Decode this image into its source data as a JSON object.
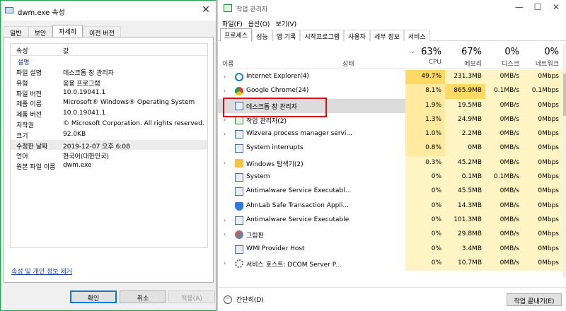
{
  "dialog": {
    "title": "dwm.exe 속성",
    "tabs": [
      "일반",
      "보안",
      "자세히",
      "이전 버전"
    ],
    "active_tab_index": 2,
    "columns": {
      "property": "속성",
      "value": "값"
    },
    "section": "설명",
    "rows": [
      {
        "property": "파일 설명",
        "value": "데스크톱 창 관리자"
      },
      {
        "property": "유형",
        "value": "응용 프로그램"
      },
      {
        "property": "파일 버전",
        "value": "10.0.19041.1"
      },
      {
        "property": "제품 이름",
        "value": "Microsoft® Windows® Operating System"
      },
      {
        "property": "제품 버전",
        "value": "10.0.19041.1"
      },
      {
        "property": "저작권",
        "value": "© Microsoft Corporation. All rights reserved."
      },
      {
        "property": "크기",
        "value": "92.0KB"
      },
      {
        "property": "수정한 날짜",
        "value": "2019-12-07 오후 6:08"
      },
      {
        "property": "언어",
        "value": "한국어(대한민국)"
      },
      {
        "property": "원본 파일 이름",
        "value": "dwm.exe"
      }
    ],
    "selected_row_index": 7,
    "remove_link": "속성 및 개인 정보 제거",
    "buttons": {
      "ok": "확인",
      "cancel": "취소",
      "apply": "적용(A)"
    },
    "close_glyph": "✕"
  },
  "taskmgr": {
    "title": "작업 관리자",
    "window_controls": {
      "minimize": "—",
      "maximize": "☐",
      "close": "✕"
    },
    "menu": [
      "파일(F)",
      "옵션(O)",
      "보기(V)"
    ],
    "tabs": [
      "프로세스",
      "성능",
      "앱 기록",
      "시작프로그램",
      "사용자",
      "세부 정보",
      "서비스"
    ],
    "active_tab_index": 0,
    "columns": {
      "name": "이름",
      "status": "상태",
      "cpu": {
        "pct": "63%",
        "label": "CPU"
      },
      "memory": {
        "pct": "67%",
        "label": "메모리"
      },
      "disk": {
        "pct": "0%",
        "label": "디스크"
      },
      "network": {
        "pct": "0%",
        "label": "네트워크"
      }
    },
    "processes": [
      {
        "name": "Internet Explorer(4)",
        "expandable": true,
        "icon": "ie-icon",
        "cpu": "49.7%",
        "mem": "231.3MB",
        "disk": "0MB/s",
        "net": "0Mbps"
      },
      {
        "name": "Google Chrome(24)",
        "expandable": true,
        "icon": "chrome-icon",
        "cpu": "8.1%",
        "mem": "865.9MB",
        "disk": "0.1MB/s",
        "net": "0.1Mbps"
      },
      {
        "name": "데스크톱 창 관리자",
        "expandable": false,
        "icon": "window-icon",
        "cpu": "1.9%",
        "mem": "19.5MB",
        "disk": "0MB/s",
        "net": "0Mbps"
      },
      {
        "name": "작업 관리자(2)",
        "expandable": true,
        "icon": "taskmgr-icon",
        "cpu": "1.3%",
        "mem": "24.9MB",
        "disk": "0MB/s",
        "net": "0Mbps"
      },
      {
        "name": "Wizvera process manager servi...",
        "expandable": true,
        "icon": "window-icon",
        "cpu": "1.0%",
        "mem": "2.2MB",
        "disk": "0MB/s",
        "net": "0Mbps"
      },
      {
        "name": "System interrupts",
        "expandable": false,
        "icon": "window-icon",
        "cpu": "0.8%",
        "mem": "0MB",
        "disk": "0MB/s",
        "net": "0Mbps"
      },
      {
        "name": "Windows 탐색기(2)",
        "expandable": true,
        "icon": "folder-icon",
        "cpu": "0.3%",
        "mem": "45.2MB",
        "disk": "0MB/s",
        "net": "0Mbps"
      },
      {
        "name": "System",
        "expandable": false,
        "icon": "window-icon",
        "cpu": "0%",
        "mem": "0.1MB",
        "disk": "0.1MB/s",
        "net": "0Mbps"
      },
      {
        "name": "Antimalware Service Executabl...",
        "expandable": false,
        "icon": "window-icon",
        "cpu": "0%",
        "mem": "45.5MB",
        "disk": "0MB/s",
        "net": "0Mbps"
      },
      {
        "name": "AhnLab Safe Transaction Appli...",
        "expandable": false,
        "icon": "shield-icon",
        "cpu": "0%",
        "mem": "14.3MB",
        "disk": "0MB/s",
        "net": "0Mbps"
      },
      {
        "name": "Antimalware Service Executable",
        "expandable": true,
        "icon": "window-icon",
        "cpu": "0%",
        "mem": "101.3MB",
        "disk": "0MB/s",
        "net": "0Mbps"
      },
      {
        "name": "그림판",
        "expandable": true,
        "icon": "paint-icon",
        "cpu": "0%",
        "mem": "29.8MB",
        "disk": "0MB/s",
        "net": "0Mbps"
      },
      {
        "name": "WMI Provider Host",
        "expandable": false,
        "icon": "window-icon",
        "cpu": "0%",
        "mem": "3.4MB",
        "disk": "0MB/s",
        "net": "0Mbps"
      },
      {
        "name": "서비스 호스트: DCOM Server P...",
        "expandable": true,
        "icon": "gear-icon",
        "cpu": "0%",
        "mem": "10.7MB",
        "disk": "0MB/s",
        "net": "0Mbps"
      }
    ],
    "selected_process_index": 2,
    "footer": {
      "fewer_details": "간단히(D)",
      "end_task": "작업 끝내기(E)"
    },
    "colors": {
      "highlight_box": "#d4101a",
      "heat_light": "#fff4c4",
      "heat_mid": "#ffeaa0",
      "heat_strong": "#ffd966"
    }
  }
}
